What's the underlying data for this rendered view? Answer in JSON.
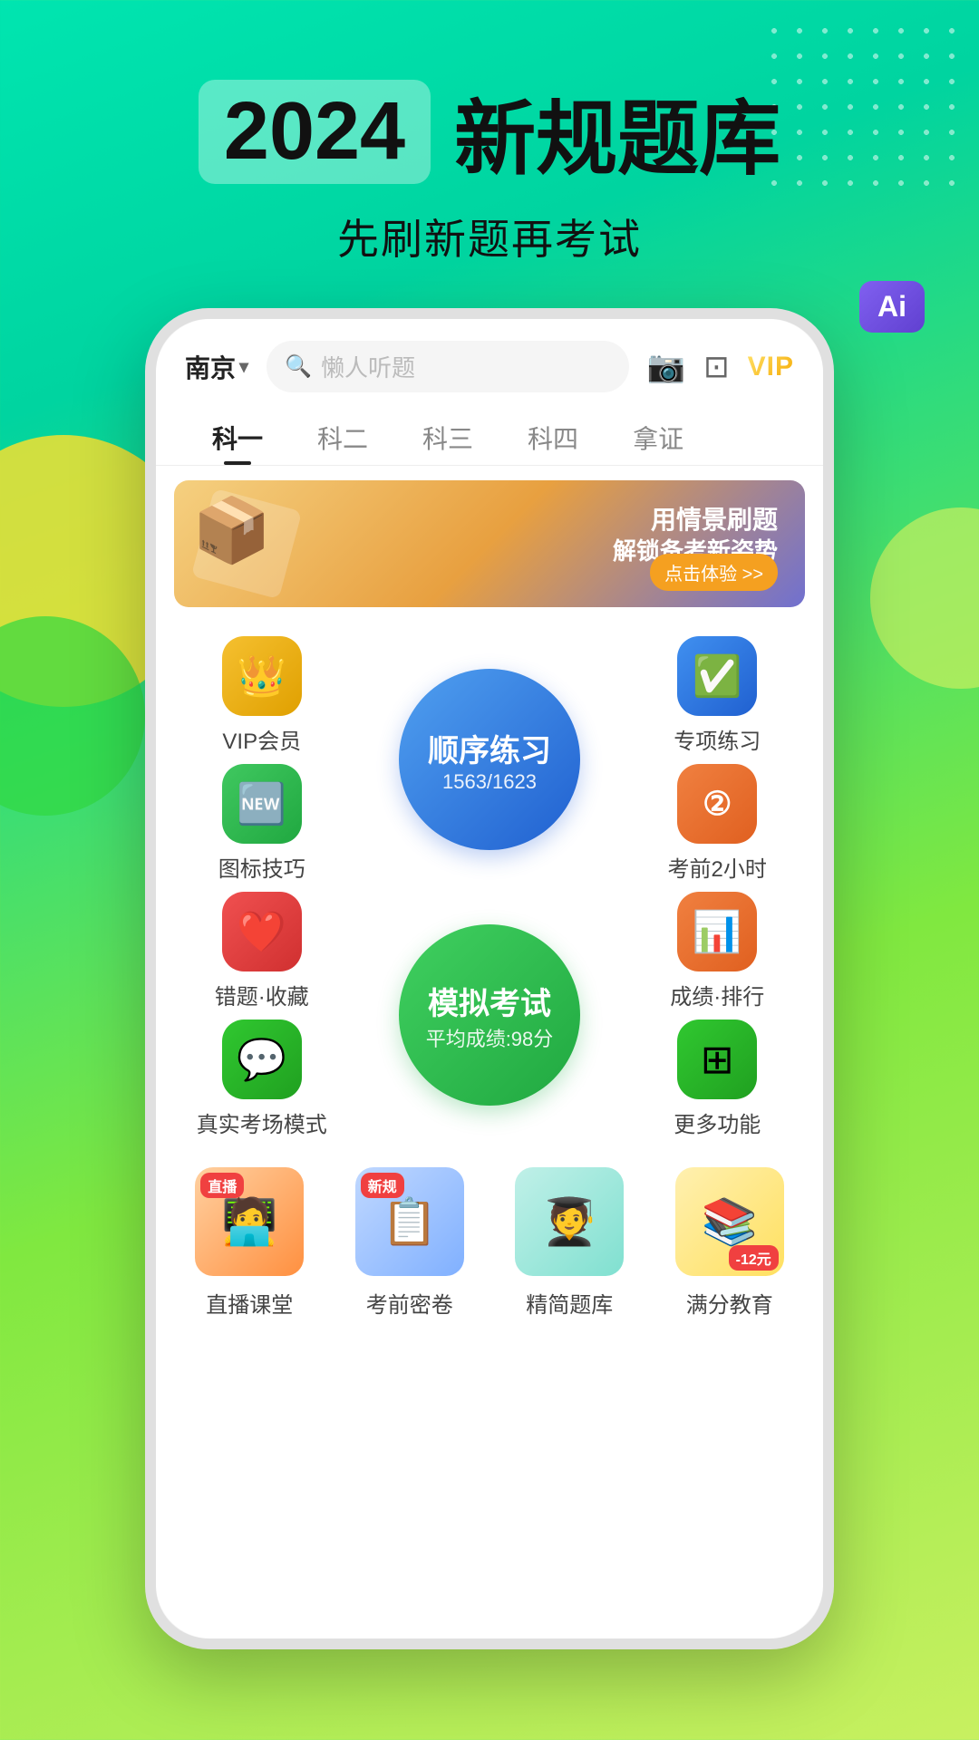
{
  "background": {
    "gradient": "linear-gradient(160deg, #00e5b0, #80e840, #c8f060)"
  },
  "hero": {
    "year": "2024",
    "title": "新规题库",
    "subtitle": "先刷新题再考试"
  },
  "phone": {
    "header": {
      "location": "南京",
      "search_placeholder": "懒人听题",
      "vip_label": "VIP"
    },
    "tabs": [
      {
        "label": "科一",
        "active": true
      },
      {
        "label": "科二",
        "active": false
      },
      {
        "label": "科三",
        "active": false
      },
      {
        "label": "科四",
        "active": false
      },
      {
        "label": "拿证",
        "active": false
      }
    ],
    "banner": {
      "text1": "用情景刷题",
      "text2": "解锁备考新姿势",
      "btn": "点击体验 >>"
    },
    "grid": {
      "left_col": [
        {
          "icon": "👑",
          "color": "yellow",
          "label": "VIP会员"
        },
        {
          "icon": "🆕",
          "color": "green-light",
          "label": "图标技巧"
        },
        {
          "icon": "❤️",
          "color": "red",
          "label": "错题·收藏"
        },
        {
          "icon": "💬",
          "color": "green",
          "label": "真实考场模式"
        }
      ],
      "right_col": [
        {
          "icon": "✅",
          "color": "blue",
          "label": "专项练习"
        },
        {
          "icon": "②",
          "color": "orange",
          "label": "考前2小时"
        },
        {
          "icon": "📊",
          "color": "orange",
          "label": "成绩·排行"
        },
        {
          "icon": "⊞",
          "color": "green",
          "label": "更多功能"
        }
      ],
      "center_circles": [
        {
          "text": "顺序练习",
          "sub": "1563/1623",
          "color": "blue"
        },
        {
          "text": "模拟考试",
          "sub": "平均成绩:98分",
          "color": "green"
        }
      ]
    },
    "categories": [
      {
        "label": "直播课堂",
        "bg": "orange-bg",
        "badge_type": "none"
      },
      {
        "label": "考前密卷",
        "bg": "blue-bg",
        "badge_type": "new"
      },
      {
        "label": "精简题库",
        "bg": "teal-bg",
        "badge_type": "none"
      },
      {
        "label": "满分教育",
        "bg": "yellow-bg",
        "badge_type": "minus"
      }
    ]
  },
  "ai_label": "Ai"
}
